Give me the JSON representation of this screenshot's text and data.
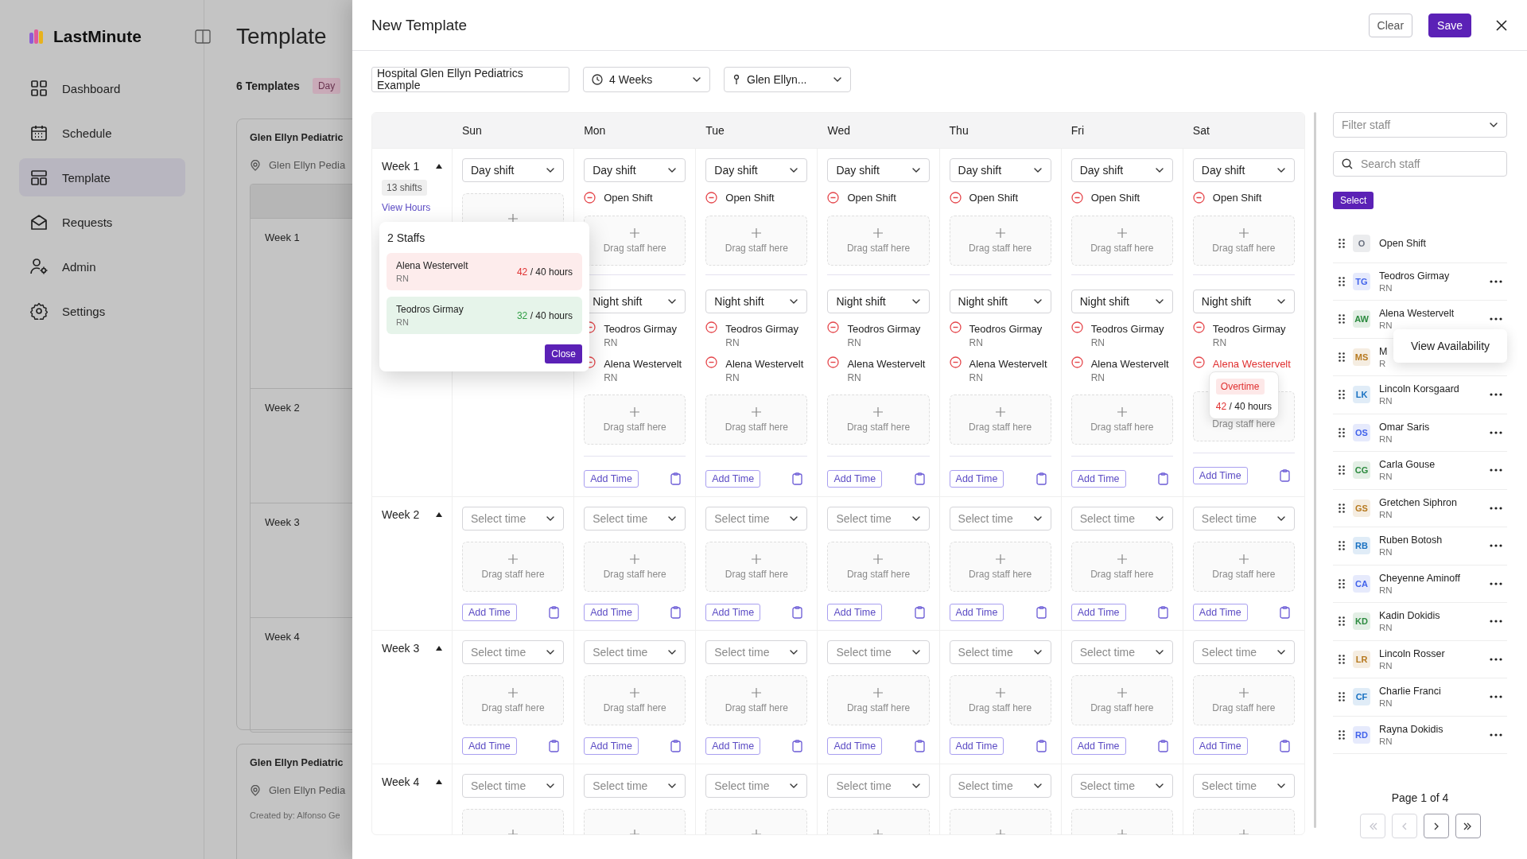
{
  "sidebar": {
    "brand": "LastMinute",
    "items": [
      {
        "label": "Dashboard",
        "kind": "dashboard",
        "selected": false
      },
      {
        "label": "Schedule",
        "kind": "schedule",
        "selected": false
      },
      {
        "label": "Template",
        "kind": "template",
        "selected": true
      },
      {
        "label": "Requests",
        "kind": "requests",
        "selected": false
      },
      {
        "label": "Admin",
        "kind": "admin",
        "selected": false
      },
      {
        "label": "Settings",
        "kind": "settings",
        "selected": false
      }
    ]
  },
  "background_page": {
    "title": "Template",
    "count": "6 Templates",
    "tag": "Day",
    "cards": [
      {
        "title": "Glen Ellyn Pediatric",
        "location": "Glen Ellyn Pedia",
        "weeks": [
          "Week 1",
          "Week 2",
          "Week 3",
          "Week 4"
        ]
      },
      {
        "title": "Glen Ellyn Pediatric",
        "location": "Glen Ellyn Pedia",
        "created_by": "Created by: Alfonso Ge"
      }
    ]
  },
  "drawer": {
    "title": "New Template",
    "buttons": [
      {
        "label": "Clear",
        "kind": "secondary"
      },
      {
        "label": "Save",
        "kind": "primary"
      }
    ],
    "name_field": {
      "value": "Hospital Glen Ellyn Pediatrics Example"
    },
    "duration": {
      "value": "4 Weeks"
    },
    "location": {
      "value": "Glen Ellyn..."
    }
  },
  "schedule": {
    "days": [
      "Sun",
      "Mon",
      "Tue",
      "Wed",
      "Thu",
      "Fri",
      "Sat"
    ],
    "weeks": [
      {
        "label": "Week 1",
        "expanded": true,
        "badge": "13 shifts",
        "link": "View Hours",
        "days": [
          {
            "shifts": [
              {
                "select": {
                  "value": "Day shift"
                }
              }
            ]
          },
          {
            "shifts": [
              {
                "select": {
                  "value": "Day shift"
                },
                "staff": [
                  {
                    "name": "Open Shift",
                    "overtime": false
                  }
                ],
                "drop": {
                  "label": "Drag staff here"
                }
              },
              {
                "select": {
                  "value": "Night shift"
                },
                "staff": [
                  {
                    "name": "Teodros Girmay",
                    "role": "RN",
                    "overtime": false
                  },
                  {
                    "name": "Alena Westervelt",
                    "role": "RN",
                    "overtime": false
                  }
                ],
                "drop": {
                  "label": "Drag staff here"
                }
              }
            ],
            "add_time": "Add Time"
          },
          {
            "shifts": [
              {
                "select": {
                  "value": "Day shift"
                },
                "staff": [
                  {
                    "name": "Open Shift",
                    "overtime": false
                  }
                ],
                "drop": {
                  "label": "Drag staff here"
                }
              },
              {
                "select": {
                  "value": "Night shift"
                },
                "staff": [
                  {
                    "name": "Teodros Girmay",
                    "role": "RN",
                    "overtime": false
                  },
                  {
                    "name": "Alena Westervelt",
                    "role": "RN",
                    "overtime": false
                  }
                ],
                "drop": {
                  "label": "Drag staff here"
                }
              }
            ],
            "add_time": "Add Time"
          },
          {
            "shifts": [
              {
                "select": {
                  "value": "Day shift"
                },
                "staff": [
                  {
                    "name": "Open Shift",
                    "overtime": false
                  }
                ],
                "drop": {
                  "label": "Drag staff here"
                }
              },
              {
                "select": {
                  "value": "Night shift"
                },
                "staff": [
                  {
                    "name": "Teodros Girmay",
                    "role": "RN",
                    "overtime": false
                  },
                  {
                    "name": "Alena Westervelt",
                    "role": "RN",
                    "overtime": false
                  }
                ],
                "drop": {
                  "label": "Drag staff here"
                }
              }
            ],
            "add_time": "Add Time"
          },
          {
            "shifts": [
              {
                "select": {
                  "value": "Day shift"
                },
                "staff": [
                  {
                    "name": "Open Shift",
                    "overtime": false
                  }
                ],
                "drop": {
                  "label": "Drag staff here"
                }
              },
              {
                "select": {
                  "value": "Night shift"
                },
                "staff": [
                  {
                    "name": "Teodros Girmay",
                    "role": "RN",
                    "overtime": false
                  },
                  {
                    "name": "Alena Westervelt",
                    "role": "RN",
                    "overtime": false
                  }
                ],
                "drop": {
                  "label": "Drag staff here"
                }
              }
            ],
            "add_time": "Add Time"
          },
          {
            "shifts": [
              {
                "select": {
                  "value": "Day shift"
                },
                "staff": [
                  {
                    "name": "Open Shift",
                    "overtime": false
                  }
                ],
                "drop": {
                  "label": "Drag staff here"
                }
              },
              {
                "select": {
                  "value": "Night shift"
                },
                "staff": [
                  {
                    "name": "Teodros Girmay",
                    "role": "RN",
                    "overtime": false
                  },
                  {
                    "name": "Alena Westervelt",
                    "role": "RN",
                    "overtime": false
                  }
                ],
                "drop": {
                  "label": "Drag staff here"
                }
              }
            ],
            "add_time": "Add Time"
          },
          {
            "shifts": [
              {
                "select": {
                  "value": "Day shift"
                },
                "staff": [
                  {
                    "name": "Open Shift",
                    "overtime": false
                  }
                ],
                "drop": {
                  "label": "Drag staff here"
                }
              },
              {
                "select": {
                  "value": "Night shift"
                },
                "staff": [
                  {
                    "name": "Teodros Girmay",
                    "role": "RN",
                    "overtime": false
                  },
                  {
                    "name": "Alena Westervelt",
                    "overtime": true,
                    "tooltip": {
                      "label": "Overtime",
                      "hours": "42",
                      "limit": "/ 40 hours"
                    }
                  }
                ],
                "drop": {
                  "label": "Drag staff here",
                  "plus": false
                }
              }
            ],
            "add_time": "Add Time"
          }
        ]
      },
      {
        "label": "Week 2",
        "expanded": true,
        "days": [
          {
            "shifts": [
              {
                "select": {
                  "placeholder": "Select time"
                },
                "drop": {
                  "label": "Drag staff here"
                }
              }
            ],
            "add_time": "Add Time"
          },
          {
            "shifts": [
              {
                "select": {
                  "placeholder": "Select time"
                },
                "drop": {
                  "label": "Drag staff here"
                }
              }
            ],
            "add_time": "Add Time"
          },
          {
            "shifts": [
              {
                "select": {
                  "placeholder": "Select time"
                },
                "drop": {
                  "label": "Drag staff here"
                }
              }
            ],
            "add_time": "Add Time"
          },
          {
            "shifts": [
              {
                "select": {
                  "placeholder": "Select time"
                },
                "drop": {
                  "label": "Drag staff here"
                }
              }
            ],
            "add_time": "Add Time"
          },
          {
            "shifts": [
              {
                "select": {
                  "placeholder": "Select time"
                },
                "drop": {
                  "label": "Drag staff here"
                }
              }
            ],
            "add_time": "Add Time"
          },
          {
            "shifts": [
              {
                "select": {
                  "placeholder": "Select time"
                },
                "drop": {
                  "label": "Drag staff here"
                }
              }
            ],
            "add_time": "Add Time"
          },
          {
            "shifts": [
              {
                "select": {
                  "placeholder": "Select time"
                },
                "drop": {
                  "label": "Drag staff here"
                }
              }
            ],
            "add_time": "Add Time"
          }
        ]
      },
      {
        "label": "Week 3",
        "expanded": true,
        "days": [
          {
            "shifts": [
              {
                "select": {
                  "placeholder": "Select time"
                },
                "drop": {
                  "label": "Drag staff here"
                }
              }
            ],
            "add_time": "Add Time"
          },
          {
            "shifts": [
              {
                "select": {
                  "placeholder": "Select time"
                },
                "drop": {
                  "label": "Drag staff here"
                }
              }
            ],
            "add_time": "Add Time"
          },
          {
            "shifts": [
              {
                "select": {
                  "placeholder": "Select time"
                },
                "drop": {
                  "label": "Drag staff here"
                }
              }
            ],
            "add_time": "Add Time"
          },
          {
            "shifts": [
              {
                "select": {
                  "placeholder": "Select time"
                },
                "drop": {
                  "label": "Drag staff here"
                }
              }
            ],
            "add_time": "Add Time"
          },
          {
            "shifts": [
              {
                "select": {
                  "placeholder": "Select time"
                },
                "drop": {
                  "label": "Drag staff here"
                }
              }
            ],
            "add_time": "Add Time"
          },
          {
            "shifts": [
              {
                "select": {
                  "placeholder": "Select time"
                },
                "drop": {
                  "label": "Drag staff here"
                }
              }
            ],
            "add_time": "Add Time"
          },
          {
            "shifts": [
              {
                "select": {
                  "placeholder": "Select time"
                },
                "drop": {
                  "label": "Drag staff here"
                }
              }
            ],
            "add_time": "Add Time"
          }
        ]
      },
      {
        "label": "Week 4",
        "expanded": true,
        "days": [
          {
            "shifts": [
              {
                "select": {
                  "placeholder": "Select time"
                }
              }
            ]
          },
          {
            "shifts": [
              {
                "select": {
                  "placeholder": "Select time"
                }
              }
            ]
          },
          {
            "shifts": [
              {
                "select": {
                  "placeholder": "Select time"
                }
              }
            ]
          },
          {
            "shifts": [
              {
                "select": {
                  "placeholder": "Select time"
                }
              }
            ]
          },
          {
            "shifts": [
              {
                "select": {
                  "placeholder": "Select time"
                }
              }
            ]
          },
          {
            "shifts": [
              {
                "select": {
                  "placeholder": "Select time"
                }
              }
            ]
          },
          {
            "shifts": [
              {
                "select": {
                  "placeholder": "Select time"
                }
              }
            ]
          }
        ]
      }
    ],
    "popover": {
      "title": "2 Staffs",
      "staff": [
        {
          "name": "Alena Westervelt",
          "role": "RN",
          "hours": "42",
          "limit": "/ 40 hours",
          "overtime": true
        },
        {
          "name": "Teodros Girmay",
          "role": "RN",
          "hours": "32",
          "limit": "/ 40 hours",
          "overtime": false
        }
      ],
      "close": "Close"
    }
  },
  "staff_panel": {
    "filter": {
      "placeholder": "Filter staff"
    },
    "search": {
      "placeholder": "Search staff"
    },
    "select_button": "Select",
    "staff": [
      {
        "initials": "O",
        "name": "Open Shift",
        "color": "#6b7280",
        "menu": false
      },
      {
        "initials": "TG",
        "name": "Teodros Girmay",
        "role": "RN",
        "color": "#4263eb",
        "menu": true
      },
      {
        "initials": "AW",
        "name": "Alena Westervelt",
        "role": "RN",
        "color": "#2b8a3e",
        "menu": true,
        "menu_popup": {
          "label": "View Availability"
        }
      },
      {
        "initials": "MS",
        "name": "M",
        "role": "R",
        "color": "#b7791f",
        "menu": false
      },
      {
        "initials": "LK",
        "name": "Lincoln Korsgaard",
        "role": "RN",
        "color": "#1971c2",
        "menu": true
      },
      {
        "initials": "OS",
        "name": "Omar Saris",
        "role": "RN",
        "color": "#4263eb",
        "menu": true
      },
      {
        "initials": "CG",
        "name": "Carla Gouse",
        "role": "RN",
        "color": "#2b8a3e",
        "menu": true
      },
      {
        "initials": "GS",
        "name": "Gretchen Siphron",
        "role": "RN",
        "color": "#b7791f",
        "menu": true
      },
      {
        "initials": "RB",
        "name": "Ruben Botosh",
        "role": "RN",
        "color": "#1971c2",
        "menu": true
      },
      {
        "initials": "CA",
        "name": "Cheyenne Aminoff",
        "role": "RN",
        "color": "#4263eb",
        "menu": true
      },
      {
        "initials": "KD",
        "name": "Kadin Dokidis",
        "role": "RN",
        "color": "#2b8a3e",
        "menu": true
      },
      {
        "initials": "LR",
        "name": "Lincoln Rosser",
        "role": "RN",
        "color": "#b7791f",
        "menu": true
      },
      {
        "initials": "CF",
        "name": "Charlie Franci",
        "role": "RN",
        "color": "#1971c2",
        "menu": true
      },
      {
        "initials": "RD",
        "name": "Rayna Dokidis",
        "role": "RN",
        "color": "#4263eb",
        "menu": true
      }
    ],
    "pager": {
      "text": "Page 1 of 4",
      "buttons": [
        {
          "kind": "first",
          "disabled": true
        },
        {
          "kind": "prev",
          "disabled": true
        },
        {
          "kind": "next",
          "disabled": false
        },
        {
          "kind": "last",
          "disabled": false
        }
      ]
    }
  }
}
